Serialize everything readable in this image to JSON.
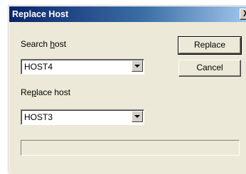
{
  "window": {
    "title": "Replace Host",
    "close_label": "X"
  },
  "search": {
    "label_prefix": "Search ",
    "label_accel": "h",
    "label_suffix": "ost",
    "value": "HOST4"
  },
  "replace": {
    "label_prefix": "Re",
    "label_accel": "p",
    "label_suffix": "lace host",
    "value": "HOST3"
  },
  "buttons": {
    "replace_label": "Replace",
    "cancel_label": "Cancel"
  },
  "progress": {
    "value": 0
  }
}
